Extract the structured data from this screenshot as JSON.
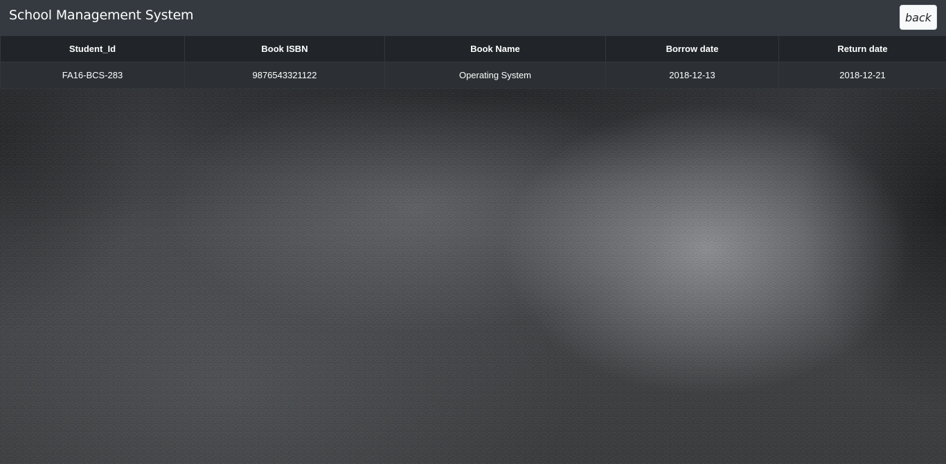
{
  "header": {
    "title": "School Management System",
    "back_label": "back"
  },
  "table": {
    "columns": [
      "Student_Id",
      "Book ISBN",
      "Book Name",
      "Borrow date",
      "Return date"
    ],
    "rows": [
      [
        "FA16-BCS-283",
        "9876543321122",
        "Operating System",
        "2018-12-13",
        "2018-12-21"
      ]
    ]
  },
  "colors": {
    "navbar": "#343a40",
    "table_header": "#212529",
    "table_row": "#2c3034",
    "button_bg": "#f8f9fa"
  }
}
